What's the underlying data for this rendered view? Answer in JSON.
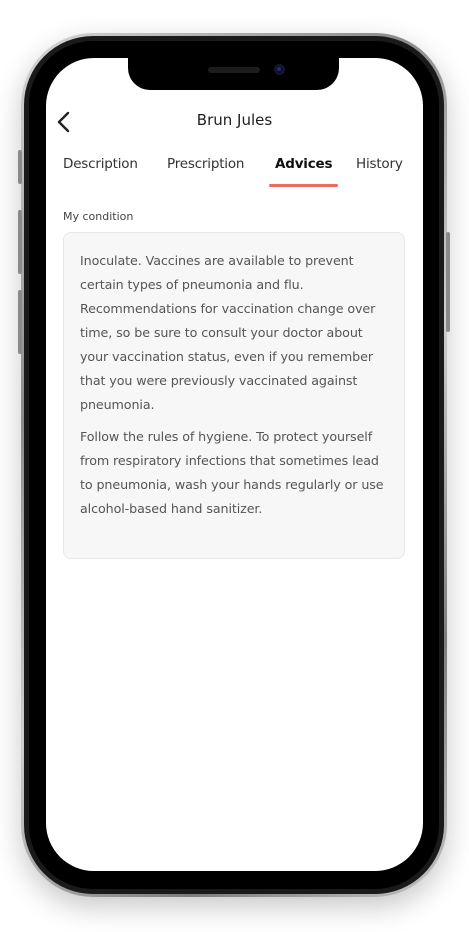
{
  "header": {
    "title": "Brun Jules"
  },
  "tabs": [
    {
      "label": "Description",
      "active": false
    },
    {
      "label": "Prescription",
      "active": false
    },
    {
      "label": "Advices",
      "active": true
    },
    {
      "label": "History",
      "active": false
    }
  ],
  "section": {
    "label": "My condition"
  },
  "advices": [
    "Inoculate. Vaccines are available to prevent certain types of pneumonia and flu. Recommendations for vaccination change over time, so be sure to consult your doctor about your vaccination status, even if you remember that you were previously vaccinated against pneumonia.",
    "Follow the rules of hygiene. To protect yourself from respiratory infections that sometimes lead to pneumonia, wash your hands regularly or use alcohol-based hand sanitizer."
  ],
  "colors": {
    "accent": "#ef6b5a",
    "card_background": "#f7f7f7",
    "text": "#555555"
  },
  "icons": {
    "back": "chevron-left-icon"
  }
}
